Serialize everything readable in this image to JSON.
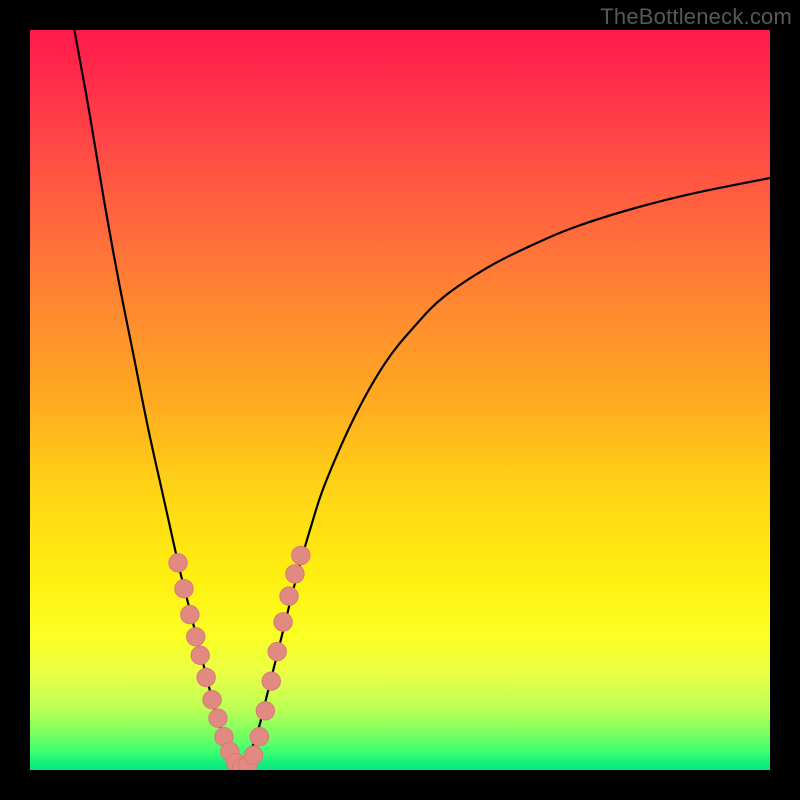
{
  "watermark": "TheBottleneck.com",
  "colors": {
    "curve": "#000000",
    "marker_fill": "#e08a82",
    "marker_stroke": "#d87a72",
    "frame": "#000000"
  },
  "chart_data": {
    "type": "line",
    "title": "",
    "xlabel": "",
    "ylabel": "",
    "x_range": [
      0,
      100
    ],
    "y_range": [
      0,
      100
    ],
    "minimum_x": 28,
    "series": [
      {
        "name": "left-branch",
        "x": [
          6,
          8,
          10,
          12,
          14,
          16,
          18,
          20,
          21,
          22,
          23,
          24,
          25,
          26,
          27,
          28
        ],
        "y": [
          100,
          89,
          77,
          66,
          56,
          46,
          37,
          28,
          24,
          20,
          16,
          12,
          8,
          5,
          2,
          0
        ]
      },
      {
        "name": "right-branch",
        "x": [
          28,
          29,
          30,
          31,
          32,
          33,
          34,
          36,
          38,
          40,
          44,
          48,
          52,
          56,
          62,
          68,
          74,
          82,
          90,
          100
        ],
        "y": [
          0,
          1,
          3,
          6,
          10,
          14,
          18,
          26,
          33,
          39,
          48,
          55,
          60,
          64,
          68,
          71,
          73.5,
          76,
          78,
          80
        ]
      }
    ],
    "markers": {
      "name": "highlight-points",
      "points": [
        {
          "x": 20.0,
          "y": 28.0
        },
        {
          "x": 20.8,
          "y": 24.5
        },
        {
          "x": 21.6,
          "y": 21.0
        },
        {
          "x": 22.4,
          "y": 18.0
        },
        {
          "x": 23.0,
          "y": 15.5
        },
        {
          "x": 23.8,
          "y": 12.5
        },
        {
          "x": 24.6,
          "y": 9.5
        },
        {
          "x": 25.4,
          "y": 7.0
        },
        {
          "x": 26.2,
          "y": 4.5
        },
        {
          "x": 27.0,
          "y": 2.5
        },
        {
          "x": 27.8,
          "y": 1.0
        },
        {
          "x": 28.6,
          "y": 0.3
        },
        {
          "x": 29.4,
          "y": 0.6
        },
        {
          "x": 30.2,
          "y": 2.0
        },
        {
          "x": 31.0,
          "y": 4.5
        },
        {
          "x": 31.8,
          "y": 8.0
        },
        {
          "x": 32.6,
          "y": 12.0
        },
        {
          "x": 33.4,
          "y": 16.0
        },
        {
          "x": 34.2,
          "y": 20.0
        },
        {
          "x": 35.0,
          "y": 23.5
        },
        {
          "x": 35.8,
          "y": 26.5
        },
        {
          "x": 36.6,
          "y": 29.0
        }
      ]
    }
  }
}
